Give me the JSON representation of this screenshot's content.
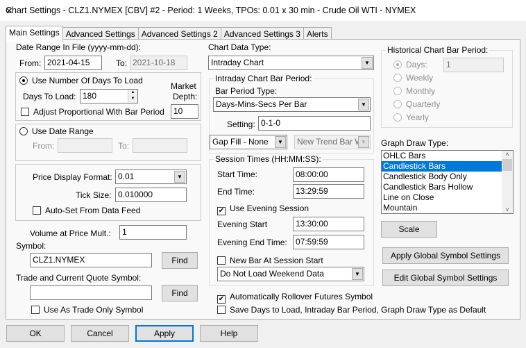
{
  "window": {
    "title": "Chart Settings - CLZ1.NYMEX [CBV]  #2 - Period: 1 Weeks, TPOs: 0.01 x 30 min   - Crude Oil WTI - NYMEX",
    "close": "✕"
  },
  "tabs": [
    "Main Settings",
    "Advanced Settings",
    "Advanced Settings 2",
    "Advanced Settings 3",
    "Alerts"
  ],
  "date_range": {
    "label": "Date Range In File (yyyy-mm-dd):",
    "from_label": "From:",
    "from": "2021-04-15",
    "to_label": "To:",
    "to": "2021-10-18"
  },
  "days": {
    "radio": "Use Number Of Days To Load",
    "days_label": "Days To Load:",
    "days": "180",
    "market_depth_label1": "Market",
    "market_depth_label2": "Depth:",
    "market_depth": "10",
    "adjust": "Adjust Proportional With Bar Period"
  },
  "date_use": {
    "radio": "Use Date Range",
    "from": "From:",
    "to": "To:"
  },
  "price": {
    "format_label": "Price Display Format:",
    "format": "0.01",
    "tick_label": "Tick Size:",
    "tick": "0.010000",
    "autoset": "Auto-Set From Data Feed"
  },
  "volume": {
    "label": "Volume at Price Mult.:",
    "value": "1"
  },
  "symbol": {
    "label": "Symbol:",
    "value": "CLZ1.NYMEX",
    "find": "Find",
    "trade_label": "Trade and Current Quote Symbol:",
    "trade_value": "",
    "find2": "Find",
    "trade_only": "Use As Trade Only Symbol"
  },
  "chart_data_type": {
    "label": "Chart Data Type:",
    "value": "Intraday Chart"
  },
  "intraday": {
    "label": "Intraday Chart Bar Period:",
    "type_label": "Bar Period Type:",
    "type": "Days-Mins-Secs Per Bar",
    "setting_label": "Setting:",
    "setting": "0-1-0",
    "gap": "Gap Fill - None",
    "trend": "New Trend Bar W"
  },
  "session": {
    "label": "Session Times (HH:MM:SS):",
    "start_label": "Start Time:",
    "start": "08:00:00",
    "end_label": "End Time:",
    "end": "13:29:59",
    "evening_cb": "Use Evening Session",
    "ev_start_label": "Evening Start",
    "ev_start": "13:30:00",
    "ev_end_label": "Evening End Time:",
    "ev_end": "07:59:59",
    "newbar": "New Bar At Session Start",
    "weekend": "Do Not Load Weekend Data"
  },
  "rollover": "Automatically Rollover Futures Symbol",
  "save_default": "Save Days to Load, Intraday Bar Period, Graph Draw Type as Default",
  "historical": {
    "label": "Historical Chart Bar Period:",
    "days": "Days:",
    "days_value": "1",
    "options": [
      "Weekly",
      "Monthly",
      "Quarterly",
      "Yearly"
    ]
  },
  "graph": {
    "label": "Graph Draw Type:",
    "items": [
      "OHLC Bars",
      "Candlestick Bars",
      "Candlestick Body Only",
      "Candlestick Bars Hollow",
      "Line on Close",
      "Mountain"
    ],
    "scale": "Scale",
    "apply_global": "Apply Global Symbol Settings",
    "edit_global": "Edit Global Symbol Settings"
  },
  "footer": {
    "ok": "OK",
    "cancel": "Cancel",
    "apply": "Apply",
    "help": "Help"
  }
}
